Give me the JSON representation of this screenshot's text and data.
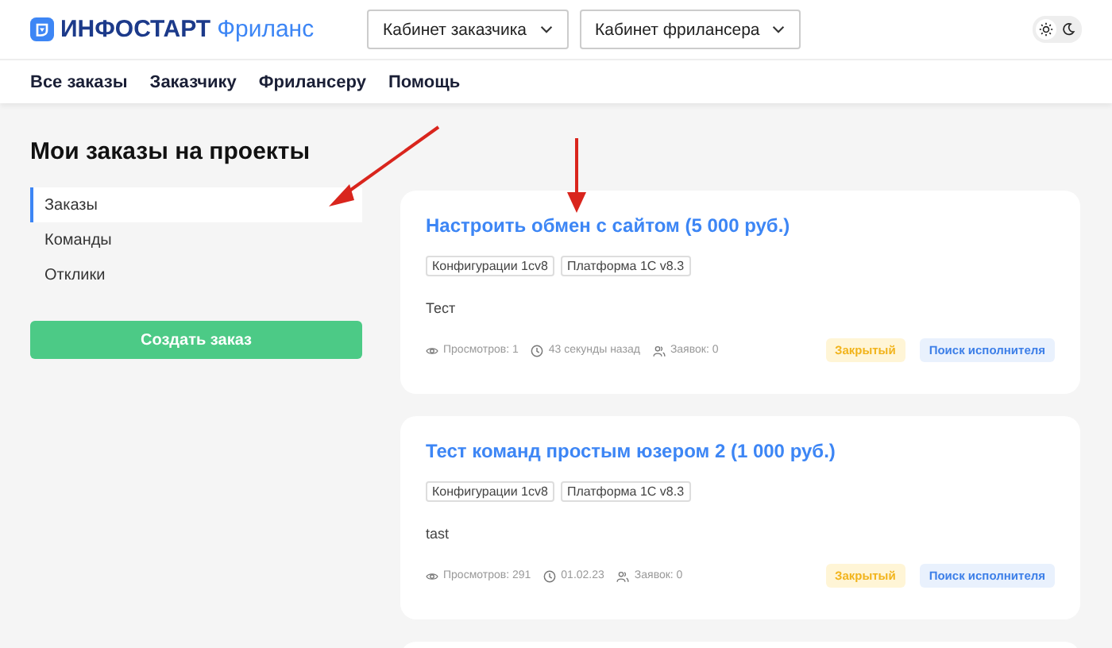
{
  "header": {
    "logo_brand": "ИНФОСТАРТ",
    "logo_product": "Фриланс",
    "dropdowns": [
      {
        "label": "Кабинет заказчика"
      },
      {
        "label": "Кабинет фрилансера"
      }
    ]
  },
  "theme_toggle": {
    "light_selected": true
  },
  "nav": [
    {
      "label": "Все заказы"
    },
    {
      "label": "Заказчику"
    },
    {
      "label": "Фрилансеру"
    },
    {
      "label": "Помощь"
    }
  ],
  "page_title": "Мои заказы на проекты",
  "sidebar": {
    "items": [
      {
        "label": "Заказы",
        "selected": true
      },
      {
        "label": "Команды",
        "selected": false
      },
      {
        "label": "Отклики",
        "selected": false
      }
    ],
    "create_button": "Создать заказ"
  },
  "orders": [
    {
      "title": "Настроить обмен с сайтом (5 000 руб.)",
      "tags": [
        "Конфигурации 1cv8",
        "Платформа 1С v8.3"
      ],
      "description": "Тест",
      "views": "Просмотров: 1",
      "time": "43 секунды назад",
      "bids": "Заявок: 0",
      "status": "Закрытый",
      "stage": "Поиск исполнителя"
    },
    {
      "title": "Тест команд простым юзером 2 (1 000 руб.)",
      "tags": [
        "Конфигурации 1cv8",
        "Платформа 1С v8.3"
      ],
      "description": "tast",
      "views": "Просмотров: 291",
      "time": "01.02.23",
      "bids": "Заявок: 0",
      "status": "Закрытый",
      "stage": "Поиск исполнителя"
    }
  ]
}
